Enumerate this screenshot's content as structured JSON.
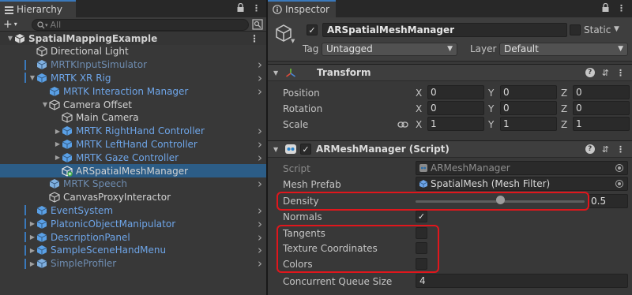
{
  "hierarchy": {
    "tab_label": "Hierarchy",
    "search_placeholder": "All",
    "items": [
      {
        "label": "SpatialMappingExample",
        "depth": 0,
        "type": "scene"
      },
      {
        "label": "Directional Light",
        "depth": 1,
        "type": "plain"
      },
      {
        "label": "MRTKInputSimulator",
        "depth": 1,
        "type": "prefab-dim",
        "chevron": true,
        "bar": true
      },
      {
        "label": "MRTK XR Rig",
        "depth": 1,
        "type": "prefab",
        "chevron": true,
        "fold": "open",
        "bar": true
      },
      {
        "label": "MRTK Interaction Manager",
        "depth": 2,
        "type": "prefab",
        "chevron": true
      },
      {
        "label": "Camera Offset",
        "depth": 2,
        "type": "plain",
        "fold": "open"
      },
      {
        "label": "Main Camera",
        "depth": 3,
        "type": "plain"
      },
      {
        "label": "MRTK RightHand Controller",
        "depth": 3,
        "type": "prefab",
        "chevron": true,
        "fold": "closed"
      },
      {
        "label": "MRTK LeftHand Controller",
        "depth": 3,
        "type": "prefab",
        "chevron": true,
        "fold": "closed"
      },
      {
        "label": "MRTK Gaze Controller",
        "depth": 3,
        "type": "prefab",
        "chevron": true,
        "fold": "closed"
      },
      {
        "label": "ARSpatialMeshManager",
        "depth": 3,
        "type": "new",
        "selected": true
      },
      {
        "label": "MRTK Speech",
        "depth": 2,
        "type": "prefab-dim",
        "chevron": true
      },
      {
        "label": "CanvasProxyInteractor",
        "depth": 2,
        "type": "plain"
      },
      {
        "label": "EventSystem",
        "depth": 1,
        "type": "prefab",
        "chevron": true,
        "bar": true
      },
      {
        "label": "PlatonicObjectManipulator",
        "depth": 1,
        "type": "prefab",
        "chevron": true,
        "fold": "closed",
        "bar": true
      },
      {
        "label": "DescriptionPanel",
        "depth": 1,
        "type": "prefab",
        "chevron": true,
        "fold": "closed",
        "bar": true
      },
      {
        "label": "SampleSceneHandMenu",
        "depth": 1,
        "type": "prefab",
        "chevron": true,
        "fold": "closed",
        "bar": true
      },
      {
        "label": "SimpleProfiler",
        "depth": 1,
        "type": "prefab-dim",
        "chevron": true,
        "fold": "closed",
        "bar": true
      }
    ]
  },
  "inspector": {
    "tab_label": "Inspector",
    "object_name": "ARSpatialMeshManager",
    "static_label": "Static",
    "tag_label": "Tag",
    "tag_value": "Untagged",
    "layer_label": "Layer",
    "layer_value": "Default",
    "transform": {
      "title": "Transform",
      "rows": [
        {
          "label": "Position",
          "x": "0",
          "y": "0",
          "z": "0"
        },
        {
          "label": "Rotation",
          "x": "0",
          "y": "0",
          "z": "0"
        },
        {
          "label": "Scale",
          "x": "1",
          "y": "1",
          "z": "1"
        }
      ],
      "axis_x": "X",
      "axis_y": "Y",
      "axis_z": "Z"
    },
    "mesh_manager": {
      "title": "ARMeshManager (Script)",
      "script_label": "Script",
      "script_value": "ARMeshManager",
      "mesh_prefab_label": "Mesh Prefab",
      "mesh_prefab_value": "SpatialMesh (Mesh Filter)",
      "density_label": "Density",
      "density_value": "0.5",
      "density_fraction": 0.5,
      "normals_label": "Normals",
      "normals_checked": true,
      "tangents_label": "Tangents",
      "tangents_checked": false,
      "texcoords_label": "Texture Coordinates",
      "texcoords_checked": false,
      "colors_label": "Colors",
      "colors_checked": false,
      "queue_label": "Concurrent Queue Size",
      "queue_value": "4"
    }
  },
  "colors": {
    "highlight": "#e0161c",
    "selection": "#2c5d87",
    "prefab_text": "#6ea5e8",
    "accent": "#3a79bb"
  }
}
